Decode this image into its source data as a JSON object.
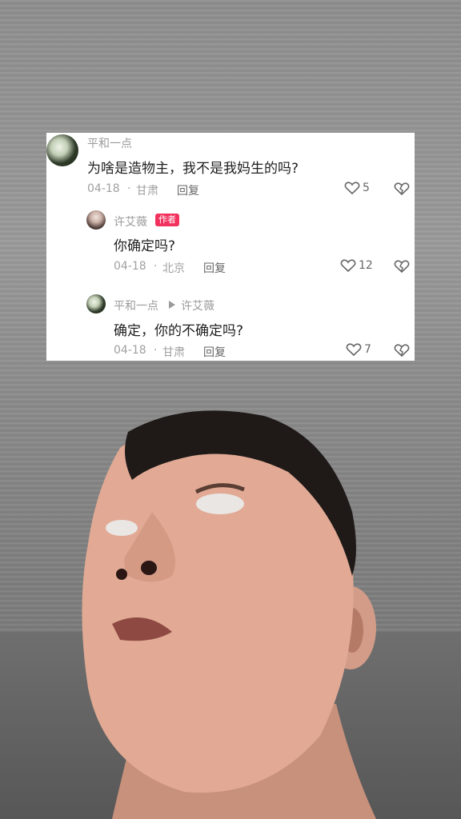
{
  "comments": [
    {
      "user": "平和一点",
      "text": "为啥是造物主，我不是我妈生的吗?",
      "date": "04-18",
      "location": "甘肃",
      "reply_label": "回复",
      "likes": "5"
    },
    {
      "user": "许艾薇",
      "badge": "作者",
      "text": "你确定吗?",
      "date": "04-18",
      "location": "北京",
      "reply_label": "回复",
      "likes": "12"
    },
    {
      "user": "平和一点",
      "reply_to": "许艾薇",
      "text": "确定，你的不确定吗?",
      "date": "04-18",
      "location": "甘肃",
      "reply_label": "回复",
      "likes": "7"
    }
  ],
  "separator": "·",
  "colors": {
    "badge": "#f2325e",
    "card": "#ffffff",
    "text": "#1f1f1f",
    "muted": "#a0a0a0"
  },
  "icons": {
    "like": "heart-icon",
    "dislike": "broken-heart-icon",
    "reply_arrow": "triangle-right-icon"
  }
}
